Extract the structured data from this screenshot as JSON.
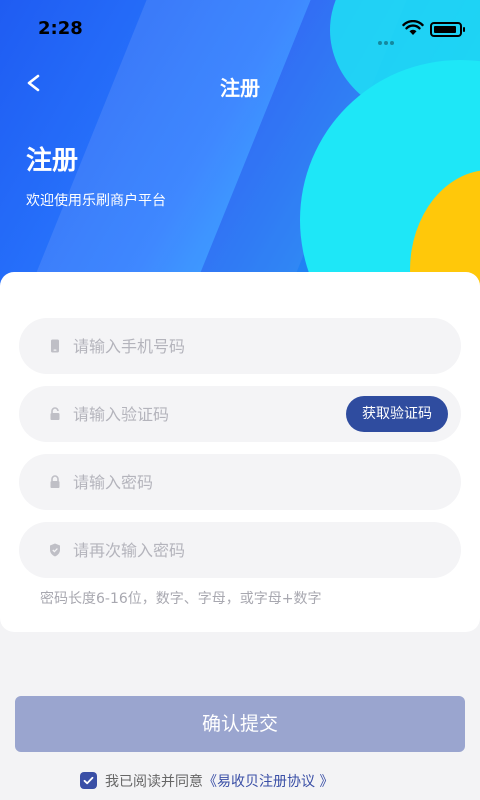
{
  "status_bar": {
    "time": "2:28"
  },
  "nav": {
    "title": "注册"
  },
  "hero": {
    "title": "注册",
    "subtitle": "欢迎使用乐刷商户平台"
  },
  "form": {
    "phone_placeholder": "请输入手机号码",
    "code_placeholder": "请输入验证码",
    "get_code_label": "获取验证码",
    "password_placeholder": "请输入密码",
    "confirm_password_placeholder": "请再次输入密码",
    "hint": "密码长度6-16位，数字、字母，或字母+数字"
  },
  "submit_label": "确认提交",
  "agreement": {
    "text": "我已阅读并同意",
    "link": "《易收贝注册协议 》",
    "checked": true
  },
  "colors": {
    "primary": "#2f4c9f",
    "submit_bg": "#9aa5cf",
    "accent_yellow": "#ffc80a",
    "accent_cyan": "#1ee7f7"
  },
  "icons": {
    "back": "chevron-left-icon",
    "phone": "phone-icon",
    "code": "unlock-icon",
    "password": "lock-icon",
    "confirm": "shield-icon"
  }
}
